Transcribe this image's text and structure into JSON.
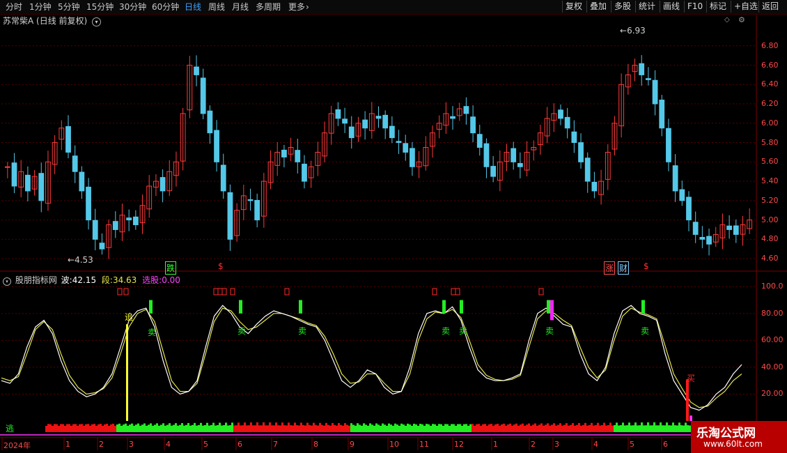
{
  "toolbar": {
    "periods": [
      "分时",
      "1分钟",
      "5分钟",
      "15分钟",
      "30分钟",
      "60分钟",
      "日线",
      "周线",
      "月线",
      "多周期",
      "更多"
    ],
    "active_period": "日线",
    "more_icon": "chevron-right-icon",
    "tools": [
      "复权",
      "叠加",
      "多股",
      "统计",
      "画线",
      "F10",
      "标记",
      "+自选",
      "返回"
    ]
  },
  "main_pane": {
    "title": "苏常柴A (日线 前复权)",
    "dropdown_icon": "chevron-down-circle-icon",
    "high_label": "6.93",
    "low_label": "4.53",
    "y_ticks": [
      "6.80",
      "6.60",
      "6.40",
      "6.20",
      "6.00",
      "5.80",
      "5.60",
      "5.40",
      "5.20",
      "5.00",
      "4.80",
      "4.60"
    ],
    "markers": [
      {
        "text": "跌",
        "color": "#38ff38"
      },
      {
        "text": "$",
        "color": "#ff3030"
      },
      {
        "text": "涨",
        "color": "#ff5050"
      },
      {
        "text": "财",
        "color": "#7fd0ff"
      },
      {
        "text": "$",
        "color": "#ff3030"
      }
    ],
    "right_icons": [
      "diamond-icon",
      "gear-icon"
    ]
  },
  "indicator_pane": {
    "name": "股朋指标网",
    "wave_label": "波:",
    "wave_value": "42.15",
    "segment_label": "段:",
    "segment_value": "34.63",
    "pick_label": "选股:",
    "pick_value": "0.00",
    "y_ticks": [
      "100.0",
      "80.00",
      "60.00",
      "40.00",
      "20.00"
    ],
    "signals": {
      "sell": "卖",
      "buy": "买",
      "chase": "追",
      "escape": "逃"
    }
  },
  "date_axis": {
    "labels": [
      "2024年",
      "1",
      "2",
      "3",
      "4",
      "5",
      "6",
      "7",
      "8",
      "9",
      "10",
      "11",
      "12",
      "1",
      "2",
      "3",
      "4",
      "5",
      "6"
    ]
  },
  "watermark": {
    "line1": "乐淘公式网",
    "line2": "www.60lt.com"
  },
  "colors": {
    "up": "#ff3b3b",
    "down": "#54c8e8",
    "grid": "#5a0000",
    "axis_text": "#ff4a4a",
    "signal_green": "#22ee22",
    "signal_magenta": "#ff22ff",
    "line_white": "#ffffff",
    "line_yellow": "#e6e64a",
    "active_tab": "#3fa0ff"
  },
  "chart_data": {
    "type": "line",
    "main": {
      "series": "candlestick",
      "y_range": [
        4.5,
        7.0
      ],
      "high": 6.93,
      "low": 4.53,
      "closes": [
        5.55,
        5.35,
        5.5,
        5.3,
        5.45,
        5.2,
        5.6,
        5.8,
        5.95,
        5.7,
        5.5,
        5.3,
        5.0,
        4.8,
        4.7,
        4.95,
        4.9,
        5.05,
        5.0,
        4.95,
        5.15,
        5.35,
        5.4,
        5.3,
        5.5,
        5.6,
        6.1,
        6.6,
        6.5,
        6.1,
        5.9,
        5.6,
        5.3,
        4.8,
        5.1,
        5.25,
        5.2,
        5.0,
        5.4,
        5.6,
        5.7,
        5.65,
        5.75,
        5.6,
        5.4,
        5.55,
        5.7,
        5.9,
        6.1,
        6.05,
        6.0,
        5.85,
        6.0,
        5.95,
        6.1,
        6.05,
        5.95,
        5.85,
        5.8,
        5.7,
        5.55,
        5.6,
        5.75,
        5.9,
        6.0,
        6.1,
        6.05,
        6.15,
        6.1,
        5.9,
        5.75,
        5.55,
        5.45,
        5.6,
        5.7,
        5.6,
        5.55,
        5.7,
        5.75,
        5.9,
        6.05,
        6.1,
        6.05,
        5.95,
        5.8,
        5.6,
        5.4,
        5.3,
        5.4,
        5.7,
        6.0,
        6.4,
        6.5,
        6.6,
        6.5,
        6.45,
        6.2,
        5.95,
        5.6,
        5.3,
        5.2,
        5.0,
        4.85,
        4.8,
        4.75,
        4.85,
        4.95,
        4.9,
        4.85,
        4.95,
        5.0
      ]
    },
    "indicator": {
      "y_range": [
        0,
        110
      ],
      "wave": [
        30,
        28,
        35,
        55,
        70,
        75,
        65,
        45,
        30,
        22,
        18,
        20,
        25,
        35,
        55,
        75,
        82,
        84,
        70,
        45,
        25,
        20,
        22,
        30,
        55,
        78,
        86,
        80,
        70,
        65,
        72,
        78,
        82,
        80,
        78,
        75,
        72,
        70,
        60,
        45,
        30,
        25,
        30,
        38,
        35,
        25,
        20,
        22,
        40,
        65,
        80,
        82,
        80,
        85,
        75,
        55,
        38,
        32,
        30,
        30,
        32,
        35,
        60,
        80,
        84,
        78,
        72,
        70,
        50,
        35,
        30,
        40,
        65,
        82,
        86,
        80,
        78,
        75,
        50,
        30,
        20,
        10,
        8,
        12,
        20,
        25,
        35,
        42
      ],
      "segment": [
        32,
        30,
        33,
        50,
        68,
        74,
        68,
        50,
        34,
        25,
        20,
        21,
        24,
        32,
        50,
        70,
        80,
        83,
        74,
        52,
        30,
        22,
        22,
        28,
        50,
        74,
        84,
        82,
        74,
        68,
        70,
        75,
        80,
        80,
        78,
        76,
        73,
        71,
        63,
        50,
        35,
        28,
        29,
        35,
        35,
        28,
        22,
        22,
        35,
        60,
        76,
        81,
        80,
        83,
        77,
        60,
        42,
        34,
        31,
        30,
        31,
        34,
        55,
        76,
        82,
        80,
        75,
        71,
        55,
        40,
        32,
        38,
        60,
        78,
        84,
        81,
        79,
        76,
        56,
        35,
        24,
        14,
        10,
        11,
        17,
        22,
        30,
        35
      ]
    }
  }
}
